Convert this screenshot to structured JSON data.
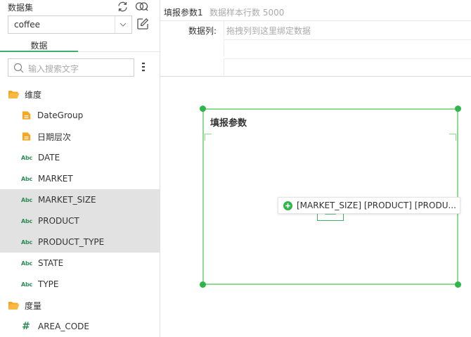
{
  "left": {
    "header": "数据集",
    "dataset_value": "coffee",
    "tab_label": "数据",
    "search_placeholder": "输入搜索文字",
    "tree": [
      {
        "label": "维度",
        "kind": "folder"
      },
      {
        "label": "DateGroup",
        "kind": "folder"
      },
      {
        "label": "日期层次",
        "kind": "folder"
      },
      {
        "label": "DATE",
        "kind": "abc"
      },
      {
        "label": "MARKET",
        "kind": "abc"
      },
      {
        "label": "MARKET_SIZE",
        "kind": "abc",
        "selected": true
      },
      {
        "label": "PRODUCT",
        "kind": "abc",
        "selected": true
      },
      {
        "label": "PRODUCT_TYPE",
        "kind": "abc",
        "selected": true
      },
      {
        "label": "STATE",
        "kind": "abc"
      },
      {
        "label": "TYPE",
        "kind": "abc"
      },
      {
        "label": "度量",
        "kind": "folder"
      },
      {
        "label": "AREA_CODE",
        "kind": "hash"
      }
    ],
    "abc_text": "Abc",
    "hash_text": "#"
  },
  "top": {
    "title": "填报参数1",
    "subtitle": "数据样本行数 5000",
    "columns_label": "数据列:",
    "columns_placeholder": "拖拽列到这里绑定数据"
  },
  "canvas": {
    "component_title": "填报参数",
    "drag_tooltip": "[MARKET_SIZE] [PRODUCT] [PRODU..."
  },
  "colors": {
    "accent": "#3bb16a",
    "selection_border": "#8fdc8f",
    "handle": "#2fb64a",
    "folder": "#f5a623",
    "selected_row": "#e2e2e2"
  }
}
